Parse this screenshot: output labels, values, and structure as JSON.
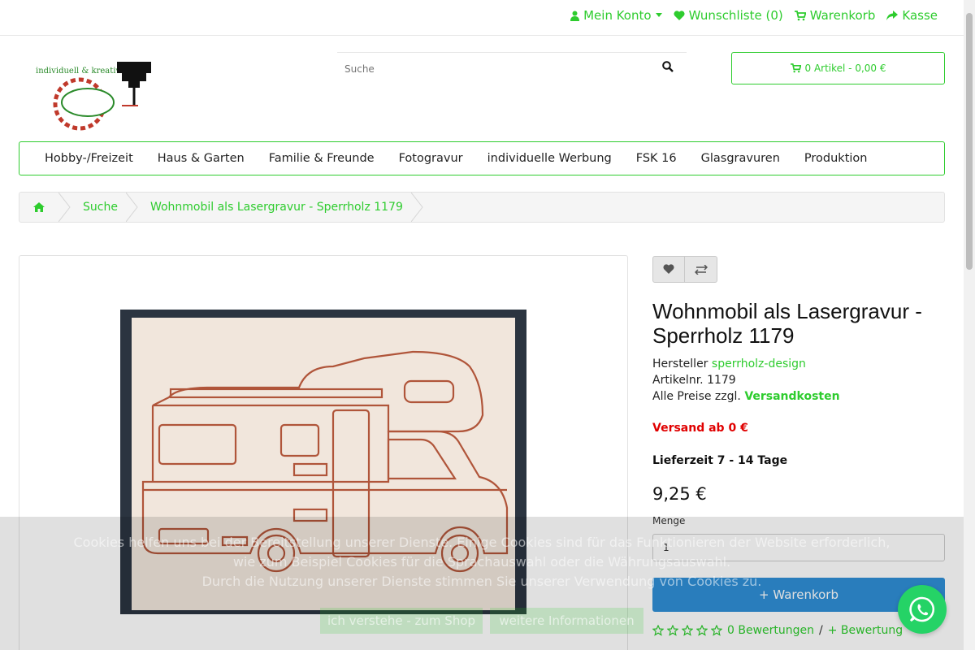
{
  "header": {
    "account": "Mein Konto",
    "wishlist": "Wunschliste (0)",
    "cart_link": "Warenkorb",
    "checkout": "Kasse"
  },
  "logo": {
    "text": "individuell & kreativ"
  },
  "search": {
    "placeholder": "Suche"
  },
  "cart": {
    "summary": "0 Artikel - 0,00 €"
  },
  "nav": {
    "items": [
      "Hobby-/Freizeit",
      "Haus & Garten",
      "Familie & Freunde",
      "Fotogravur",
      "individuelle Werbung",
      "FSK 16",
      "Glasgravuren",
      "Produktion"
    ]
  },
  "breadcrumb": {
    "items": [
      "Suche",
      "Wohnmobil als Lasergravur - Sperrholz 1179"
    ]
  },
  "product": {
    "title": "Wohnmobil als Lasergravur - Sperrholz 1179",
    "manufacturer_label": "Hersteller",
    "manufacturer": "sperrholz-design",
    "sku_label": "Artikelnr.",
    "sku": "1179",
    "prices_note": "Alle Preise zzgl.",
    "shipping_link": "Versandkosten",
    "shipping_from": "Versand ab 0 €",
    "delivery": "Lieferzeit 7 - 14 Tage",
    "price": "9,25 €",
    "quantity_label": "Menge",
    "quantity": "1",
    "add_to_cart": "+ Warenkorb",
    "reviews": "0 Bewertungen",
    "add_review": "+ Bewertung"
  },
  "cookie": {
    "line1": "Cookies helfen uns bei der Bereitstellung unserer Dienste. Einige Cookies sind für das Funktionieren der Website erforderlich,",
    "line2": "wie zum Beispiel Cookies für die Sprachauswahl oder die Währungsauswahl.",
    "line3": "Durch die Nutzung unserer Dienste stimmen Sie unserer Verwendung von Cookies zu.",
    "accept": "ich verstehe - zum Shop",
    "more": "weitere Informationen"
  },
  "colors": {
    "accent": "#2ecc2e",
    "button": "#2f8fd6",
    "alert": "#e00000"
  }
}
